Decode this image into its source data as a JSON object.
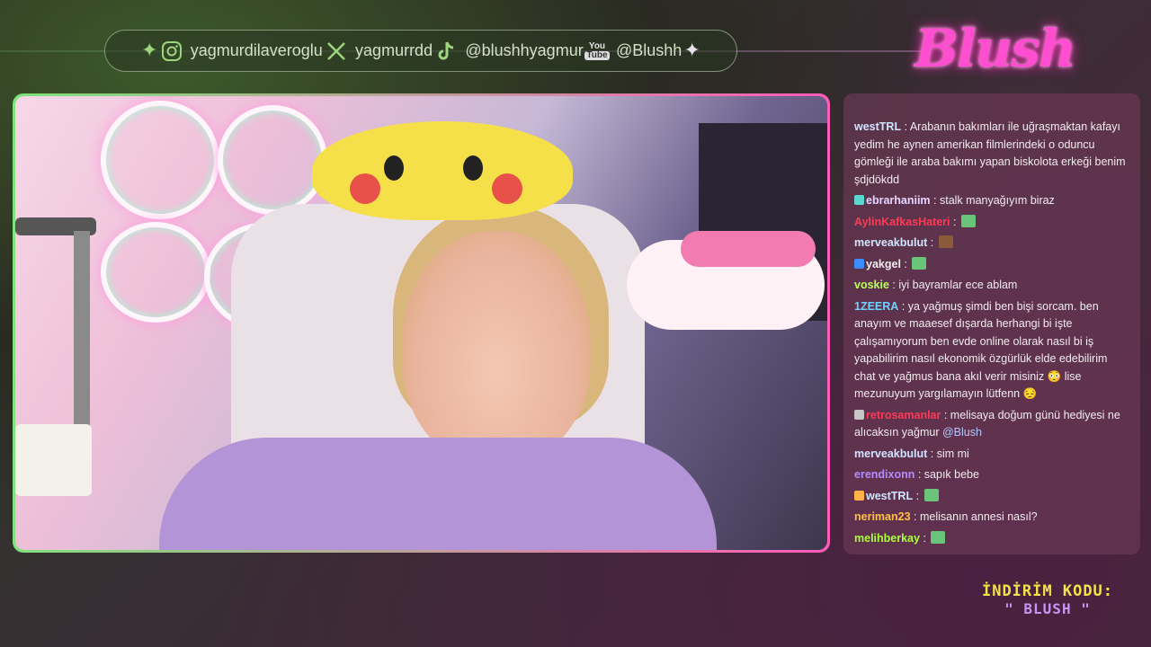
{
  "social": {
    "instagram": "yagmurdilaveroglu",
    "x": "yagmurrdd",
    "tiktok": "@blushhyagmur",
    "youtube": "@Blushh",
    "youtube_icon_top": "You",
    "youtube_icon_bottom": "Tube",
    "sparkle_glyph": "✦"
  },
  "logo": {
    "text": "Blush",
    "color": "#ff4fd0"
  },
  "chat": {
    "messages": [
      {
        "user": "westTRL",
        "color": "#cfe6ff",
        "text": "Arabanın bakımları ile uğraşmaktan kafayı yedim he aynen amerikan filmlerindeki o oduncu gömleği ile araba bakımı yapan biskolota erkeği benim şdjdökdd"
      },
      {
        "user": "ebrarhaniim",
        "color": "#e6d6ff",
        "text": "stalk manyağıyım biraz"
      },
      {
        "user": "AylinKafkasHateri",
        "color": "#ff3a55",
        "text": ""
      },
      {
        "user": "merveakbulut",
        "color": "#cfe6ff",
        "text": ""
      },
      {
        "user": "yakgel",
        "color": "#f3ecf1",
        "text": ""
      },
      {
        "user": "voskie",
        "color": "#b8ff5a",
        "text": "iyi bayramlar ece ablam"
      },
      {
        "user": "1ZEERA",
        "color": "#6fd3ff",
        "text": "ya yağmuş şimdi ben bişi sorcam. ben anayım ve maaesef dışarda herhangi bi işte çalışamıyorum ben evde online olarak nasıl bi iş yapabilirim nasıl ekonomik özgürlük elde edebilirim chat ve yağmus bana akıl verir misiniz 😳 lise mezunuyum yargılamayın lütfenn 😔"
      },
      {
        "user": "retrosamanlar",
        "color": "#ff3a55",
        "text": "melisaya doğum günü hediyesi ne alıcaksın yağmur",
        "mention": "@Blush"
      },
      {
        "user": "merveakbulut",
        "color": "#cfe6ff",
        "text": "sim mi"
      },
      {
        "user": "erendixonn",
        "color": "#b58cff",
        "text": "sapık bebe"
      },
      {
        "user": "westTRL",
        "color": "#cfe6ff",
        "text": ""
      },
      {
        "user": "neriman23",
        "color": "#ffc04a",
        "text": "melisanın annesi nasıl?"
      },
      {
        "user": "melihberkay",
        "color": "#a9ff3a",
        "text": ""
      }
    ]
  },
  "promo": {
    "label": "İNDİRİM KODU:",
    "code": "\" BLUSH \""
  }
}
